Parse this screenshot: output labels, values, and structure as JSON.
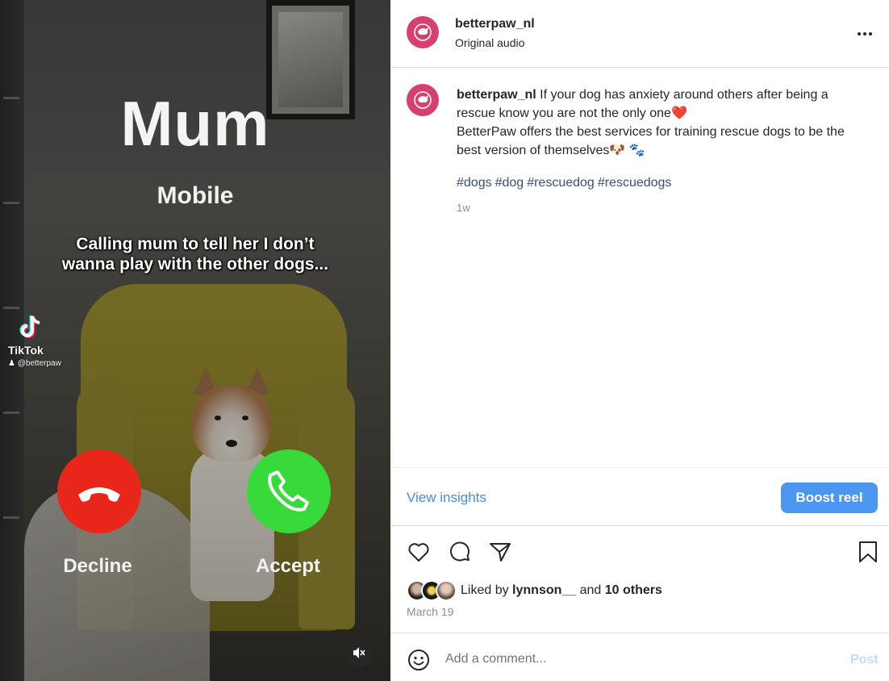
{
  "video": {
    "caller_name": "Mum",
    "caller_type": "Mobile",
    "caption_line1": "Calling mum to tell her I don’t",
    "caption_line2": "wanna play with the other dogs...",
    "tiktok_name": "TikTok",
    "tiktok_handle": "@betterpaw",
    "decline_label": "Decline",
    "accept_label": "Accept",
    "colors": {
      "decline": "#e8261a",
      "accept": "#37d93b"
    }
  },
  "header": {
    "username": "betterpaw_nl",
    "audio": "Original audio"
  },
  "post": {
    "username": "betterpaw_nl",
    "line1": " If your dog has anxiety around others after being a rescue know you are not the only one",
    "heart": "❤️",
    "line2": "BetterPaw offers the best services for training rescue dogs to be the best version of themselves",
    "emoji_dog": "🐶",
    "emoji_paws": "🐾",
    "hashtags": [
      "#dogs",
      "#dog",
      "#rescuedog",
      "#rescuedogs"
    ],
    "posted_ago": "1w"
  },
  "insights": {
    "view_label": "View insights",
    "boost_label": "Boost reel",
    "boost_color": "#4a96f0"
  },
  "likes": {
    "prefix": "Liked by ",
    "user": "lynnson__",
    "middle": " and ",
    "others": "10 others",
    "date": "March 19"
  },
  "comment": {
    "placeholder": "Add a comment...",
    "post_label": "Post"
  }
}
